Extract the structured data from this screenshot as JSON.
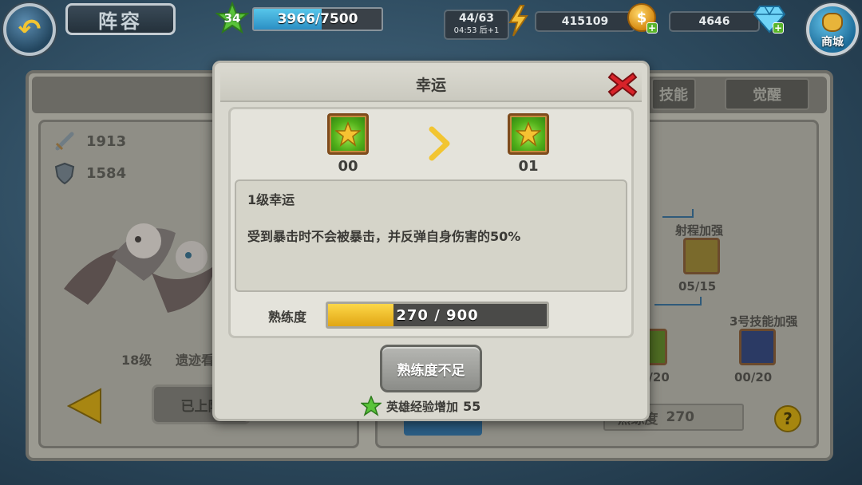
{
  "header": {
    "back_icon": "back-arrow-icon",
    "title": "阵容",
    "level": "34",
    "xp": {
      "text": "3966/7500",
      "current": 3966,
      "max": 7500
    },
    "stamina": {
      "value": "44/63",
      "timer": "04:53 后+1"
    },
    "gold": "415109",
    "gems": "4646",
    "shop_label": "商城",
    "plus_glyph": "+",
    "coin_glyph": "$"
  },
  "background": {
    "attack": "1913",
    "defense": "1584",
    "hero_level": "18级",
    "hero_name_partial": "遗迹看",
    "equipped_button_partial": "已上阵",
    "tab_skills_partial": "技能",
    "tab_awaken": "觉醒",
    "range_boost_label": "射程加强",
    "range_boost_progress": "05/15",
    "skill3_boost_label": "3号技能加强",
    "skill3_boost_progress": "00/20",
    "left_skill_progress_partial": "0/20",
    "mastery_partial": "熟练度",
    "mastery_value": "270",
    "help_glyph": "?"
  },
  "modal": {
    "title": "幸运",
    "current_level": "00",
    "next_level": "01",
    "desc_title": "1级幸运",
    "desc_text": "受到暴击时不会被暴击，并反弹自身伤害的50%",
    "proficiency_label": "熟练度",
    "proficiency": {
      "text": "270 / 900",
      "current": 270,
      "max": 900
    },
    "action_button": "熟练度不足",
    "reward_label": "英雄经验增加",
    "reward_value": "55"
  },
  "colors": {
    "xp_fill": "#2b8fc4",
    "proficiency_fill": "#fcd748",
    "close_red": "#d8232a",
    "star_green": "#5ac43a",
    "accent_yellow": "#f2c531"
  }
}
